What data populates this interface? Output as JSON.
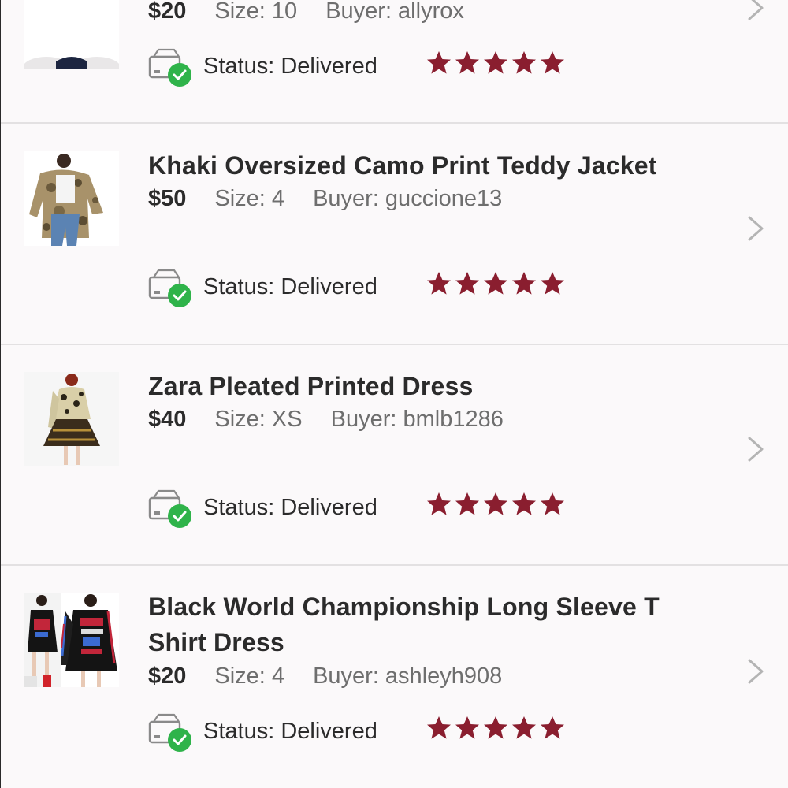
{
  "colors": {
    "star": "#8a1e2f",
    "check": "#2fb34a",
    "divider": "#e3e1e2",
    "background": "#fbf9fa"
  },
  "items": [
    {
      "title": "",
      "price": "$20",
      "size": "Size: 10",
      "buyer": "Buyer: allyrox",
      "status_label": "Status:",
      "status_value": "Delivered",
      "rating": 5
    },
    {
      "title": "Khaki Oversized Camo Print Teddy Jacket",
      "price": "$50",
      "size": "Size: 4",
      "buyer": "Buyer: guccione13",
      "status_label": "Status:",
      "status_value": "Delivered",
      "rating": 5
    },
    {
      "title": "Zara Pleated Printed Dress",
      "price": "$40",
      "size": "Size: XS",
      "buyer": "Buyer: bmlb1286",
      "status_label": "Status:",
      "status_value": "Delivered",
      "rating": 5
    },
    {
      "title": "Black World Championship Long Sleeve T Shirt Dress",
      "price": "$20",
      "size": "Size: 4",
      "buyer": "Buyer: ashleyh908",
      "status_label": "Status:",
      "status_value": "Delivered",
      "rating": 5
    }
  ],
  "icons": {
    "status": "delivered-package-icon",
    "chevron": "chevron-right-icon",
    "star": "star-icon"
  }
}
